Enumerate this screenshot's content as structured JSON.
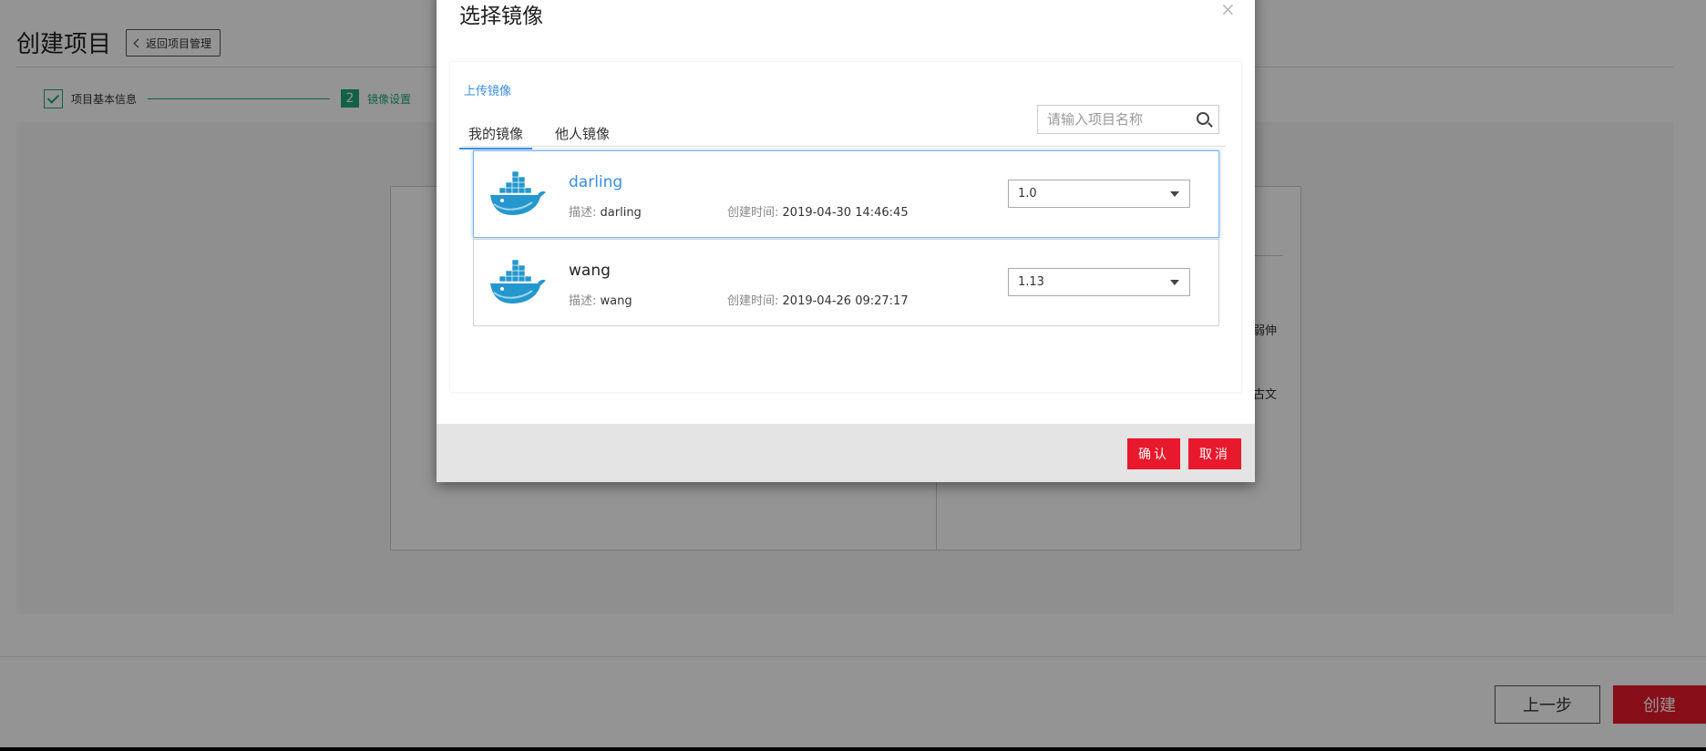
{
  "page": {
    "title": "创建项目",
    "back_label": "返回项目管理",
    "steps": [
      {
        "label": "项目基本信息"
      },
      {
        "number": "2",
        "label": "镜像设置"
      }
    ],
    "side_fragments": [
      "弱伸",
      "古文"
    ],
    "prev_label": "上一步",
    "create_label": "创建"
  },
  "modal": {
    "title": "选择镜像",
    "close_glyph": "×",
    "upload_label": "上传镜像",
    "tabs": [
      {
        "label": "我的镜像",
        "active": true
      },
      {
        "label": "他人镜像",
        "active": false
      }
    ],
    "search_placeholder": "请输入项目名称",
    "images": [
      {
        "name": "darling",
        "desc_label": "描述:",
        "desc": "darling",
        "time_label": "创建时间:",
        "time": "2019-04-30 14:46:45",
        "version": "1.0",
        "selected": true
      },
      {
        "name": "wang",
        "desc_label": "描述:",
        "desc": "wang",
        "time_label": "创建时间:",
        "time": "2019-04-26 09:27:17",
        "version": "1.13",
        "selected": false
      }
    ],
    "confirm_label": "确认",
    "cancel_label": "取消"
  },
  "colors": {
    "accent": "#3a8ee6",
    "step_green": "#1fa77a",
    "button_red": "#e8192c",
    "docker_blue": "#2497ce"
  },
  "icons": [
    "chevron-left-icon",
    "check-icon",
    "close-icon",
    "search-icon",
    "docker-whale-icon",
    "caret-down-icon"
  ]
}
